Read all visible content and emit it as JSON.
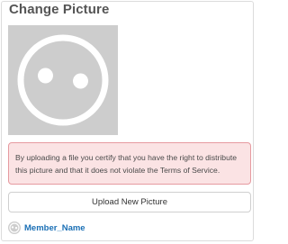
{
  "header": {
    "title": "Change Picture"
  },
  "profile_picture": {
    "icon": "default-avatar-icon",
    "background": "#cdcdcd",
    "foreground": "#ffffff"
  },
  "notice": {
    "text": "By uploading a file you certify that you have the right to distribute this picture and that it does not violate the Terms of Service.",
    "background": "#fbe3e4",
    "border_color": "#e69aa0"
  },
  "upload_button": {
    "label": "Upload New Picture"
  },
  "member": {
    "name": "Member_Name",
    "icon": "member-avatar-icon",
    "link_color": "#1a6fb5"
  }
}
